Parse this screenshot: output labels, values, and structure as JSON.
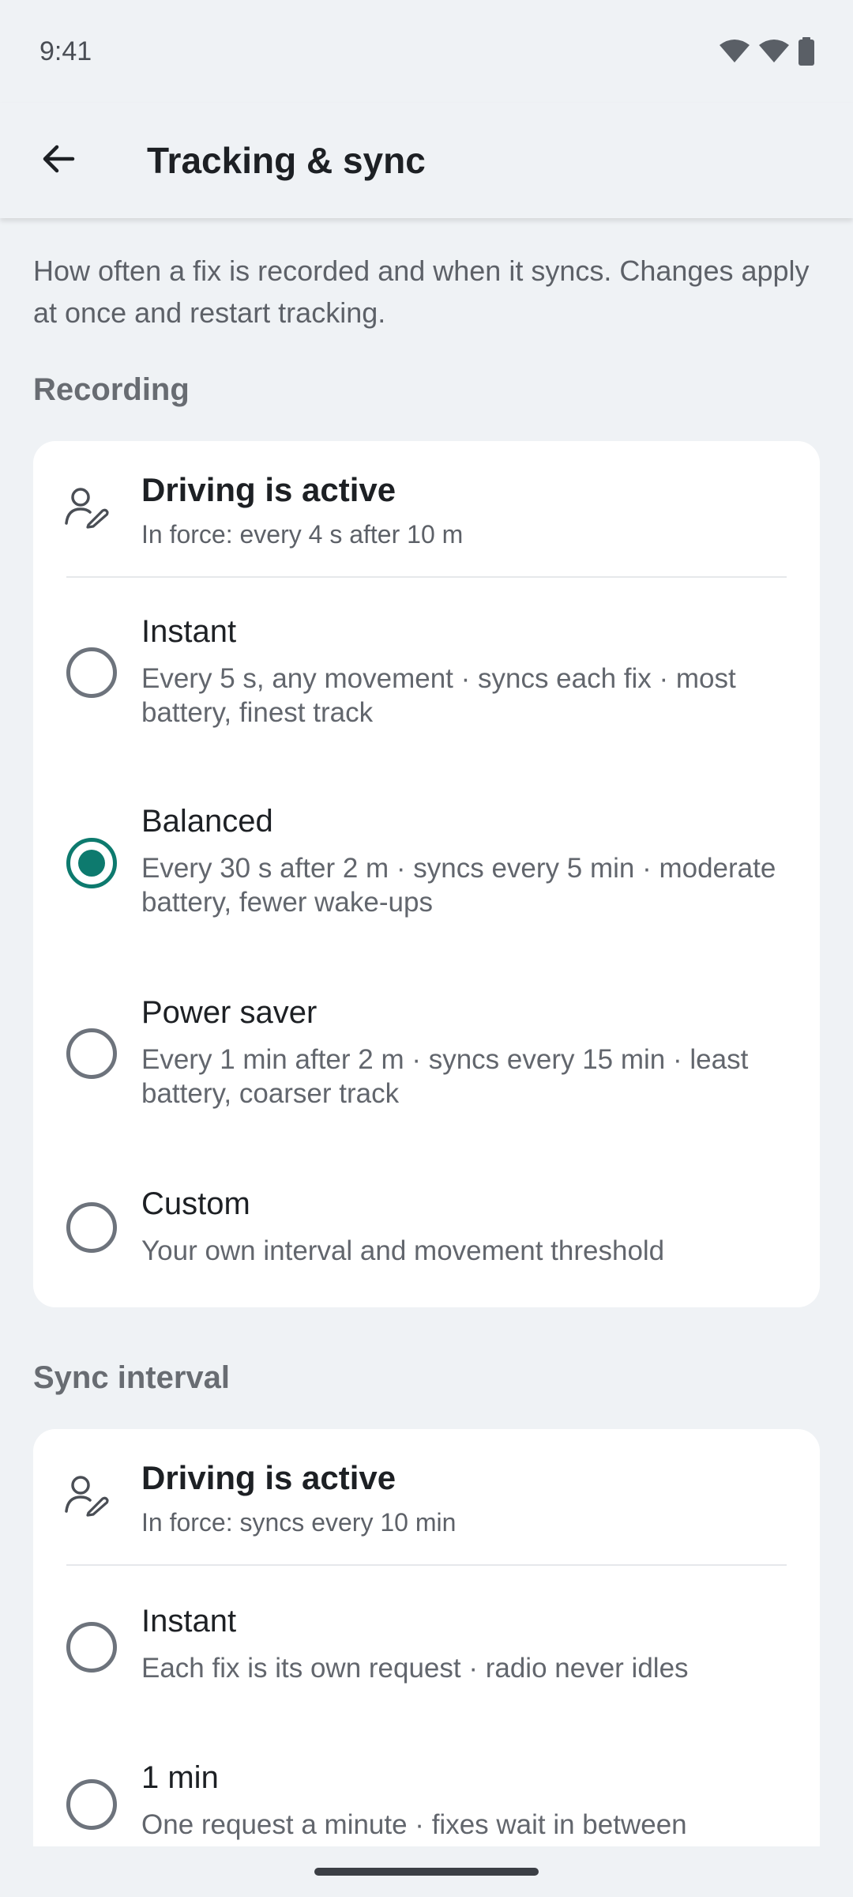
{
  "status_bar": {
    "time": "9:41"
  },
  "app_bar": {
    "title": "Tracking & sync"
  },
  "intro": "How often a fix is recorded and when it syncs. Changes apply at once and restart tracking.",
  "recording": {
    "title": "Recording",
    "active": {
      "title": "Driving is active",
      "subtitle": "In force: every 4 s after 10 m"
    },
    "options": [
      {
        "title": "Instant",
        "desc": "Every 5 s, any movement · syncs each fix · most battery, finest track",
        "selected": false
      },
      {
        "title": "Balanced",
        "desc": "Every 30 s after 2 m · syncs every 5 min · moderate battery, fewer wake-ups",
        "selected": true
      },
      {
        "title": "Power saver",
        "desc": "Every 1 min after 2 m · syncs every 15 min · least battery, coarser track",
        "selected": false
      },
      {
        "title": "Custom",
        "desc": "Your own interval and movement threshold",
        "selected": false
      }
    ]
  },
  "sync": {
    "title": "Sync interval",
    "active": {
      "title": "Driving is active",
      "subtitle": "In force: syncs every 10 min"
    },
    "options": [
      {
        "title": "Instant",
        "desc": "Each fix is its own request · radio never idles",
        "selected": false
      },
      {
        "title": "1 min",
        "desc": "One request a minute · fixes wait in between",
        "selected": false
      }
    ]
  },
  "colors": {
    "accent": "#0d7a6e",
    "background": "#eff2f5",
    "card": "#ffffff"
  },
  "icons": [
    "back-arrow-icon",
    "wifi-icon",
    "signal-icon",
    "battery-icon",
    "person-edit-icon"
  ]
}
